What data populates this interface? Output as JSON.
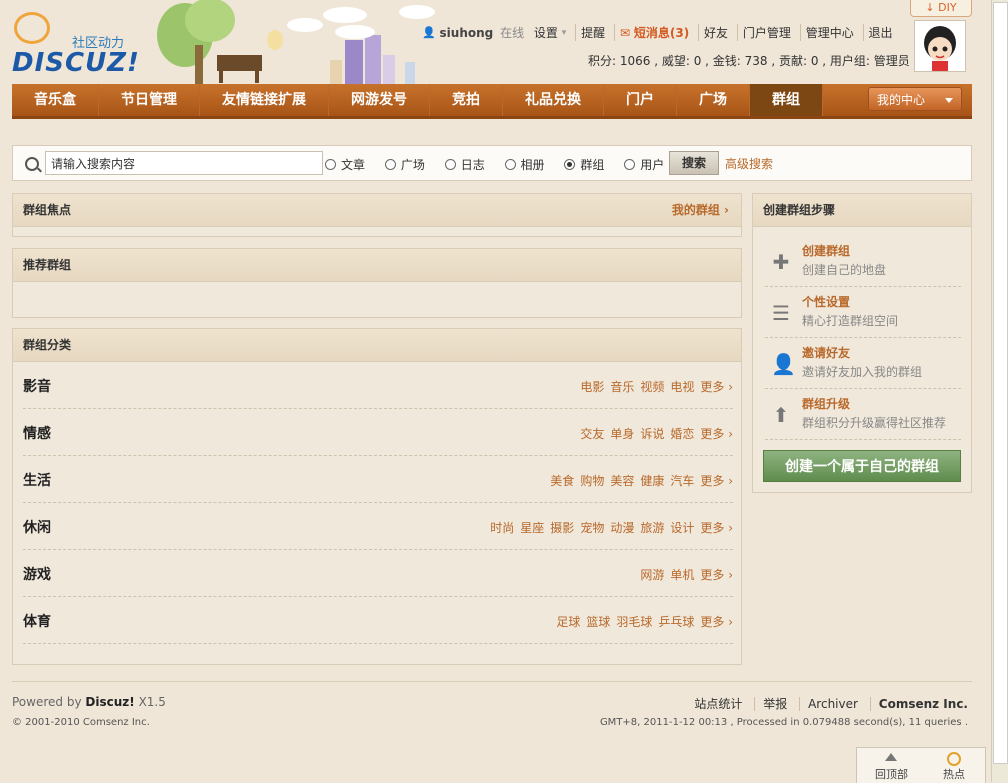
{
  "header": {
    "logo_tagline": "社区动力",
    "logo_text": "DISCUZ!",
    "diy_label": "DIY",
    "user": {
      "name": "siuhong",
      "status": "在线",
      "links": [
        "设置",
        "提醒",
        "短消息(3)",
        "好友",
        "门户管理",
        "管理中心",
        "退出"
      ],
      "stats": "积分: 1066 , 威望: 0 , 金钱: 738 , 贡献: 0 , 用户组: 管理员"
    }
  },
  "nav": {
    "items": [
      "音乐盒",
      "节日管理",
      "友情链接扩展",
      "网游发号",
      "竞拍",
      "礼品兑换",
      "门户",
      "广场",
      "群组"
    ],
    "active": "群组",
    "my_center": "我的中心"
  },
  "search": {
    "placeholder": "请输入搜索内容",
    "value": "请输入搜索内容",
    "options": [
      "文章",
      "广场",
      "日志",
      "相册",
      "群组",
      "用户"
    ],
    "selected": "群组",
    "button": "搜索",
    "advanced": "高级搜索"
  },
  "focus": {
    "title": "群组焦点",
    "my_groups": "我的群组 ›"
  },
  "recommend": {
    "title": "推荐群组"
  },
  "categories": {
    "title": "群组分类",
    "more_label": "更多 ›",
    "rows": [
      {
        "name": "影音",
        "tags": [
          "电影",
          "音乐",
          "视频",
          "电视"
        ]
      },
      {
        "name": "情感",
        "tags": [
          "交友",
          "单身",
          "诉说",
          "婚恋"
        ]
      },
      {
        "name": "生活",
        "tags": [
          "美食",
          "购物",
          "美容",
          "健康",
          "汽车"
        ]
      },
      {
        "name": "休闲",
        "tags": [
          "时尚",
          "星座",
          "摄影",
          "宠物",
          "动漫",
          "旅游",
          "设计"
        ]
      },
      {
        "name": "游戏",
        "tags": [
          "网游",
          "单机"
        ]
      },
      {
        "name": "体育",
        "tags": [
          "足球",
          "篮球",
          "羽毛球",
          "乒乓球"
        ]
      }
    ]
  },
  "steps": {
    "title": "创建群组步骤",
    "items": [
      {
        "title": "创建群组",
        "desc": "创建自己的地盘",
        "icon": "plus-icon"
      },
      {
        "title": "个性设置",
        "desc": "精心打造群组空间",
        "icon": "list-icon"
      },
      {
        "title": "邀请好友",
        "desc": "邀请好友加入我的群组",
        "icon": "user-icon"
      },
      {
        "title": "群组升级",
        "desc": "群组积分升级赢得社区推荐",
        "icon": "arrow-up-icon"
      }
    ],
    "create_button": "创建一个属于自己的群组"
  },
  "footer": {
    "powered_prefix": "Powered by",
    "powered_brand": "Discuz!",
    "version": "X1.5",
    "copyright": "© 2001-2010 Comsenz Inc.",
    "links": [
      "站点统计",
      "举报",
      "Archiver",
      "Comsenz Inc."
    ],
    "gmt": "GMT+8, 2011-1-12 00:13 , Processed in 0.079488 second(s), 11 queries ."
  },
  "float": {
    "top": "回顶部",
    "hot": "热点"
  }
}
